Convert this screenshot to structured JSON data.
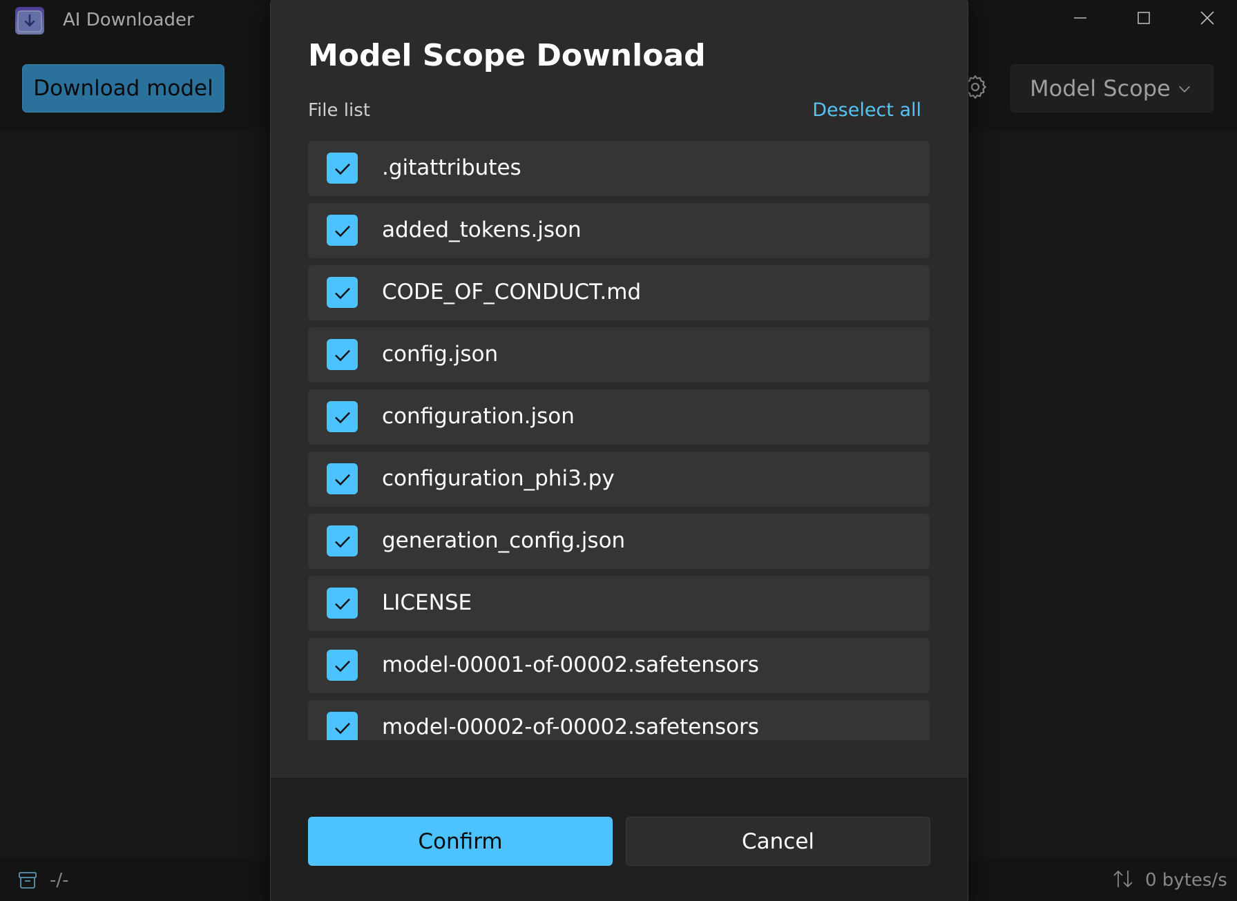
{
  "app": {
    "title": "AI Downloader"
  },
  "toolbar": {
    "download_label": "Download model",
    "source_selected": "Model Scope"
  },
  "statusbar": {
    "left_text": "-/-",
    "speed_text": "0 bytes/s"
  },
  "dialog": {
    "title": "Model Scope Download",
    "file_list_label": "File list",
    "deselect_all_label": "Deselect all",
    "files": [
      {
        "name": ".gitattributes",
        "checked": true
      },
      {
        "name": "added_tokens.json",
        "checked": true
      },
      {
        "name": "CODE_OF_CONDUCT.md",
        "checked": true
      },
      {
        "name": "config.json",
        "checked": true
      },
      {
        "name": "configuration.json",
        "checked": true
      },
      {
        "name": "configuration_phi3.py",
        "checked": true
      },
      {
        "name": "generation_config.json",
        "checked": true
      },
      {
        "name": "LICENSE",
        "checked": true
      },
      {
        "name": "model-00001-of-00002.safetensors",
        "checked": true
      },
      {
        "name": "model-00002-of-00002.safetensors",
        "checked": true
      }
    ],
    "confirm_label": "Confirm",
    "cancel_label": "Cancel"
  },
  "colors": {
    "accent": "#4cc2ff",
    "primary_button": "#3b9fd8",
    "background": "#202020"
  },
  "icons": {
    "app_logo": "download-box-icon",
    "minimize": "minimize-icon",
    "maximize": "maximize-icon",
    "close": "close-icon",
    "settings": "gear-icon",
    "dropdown": "chevron-down-icon",
    "archive": "archive-icon",
    "speed": "up-down-arrows-icon",
    "check": "checkmark-icon"
  }
}
